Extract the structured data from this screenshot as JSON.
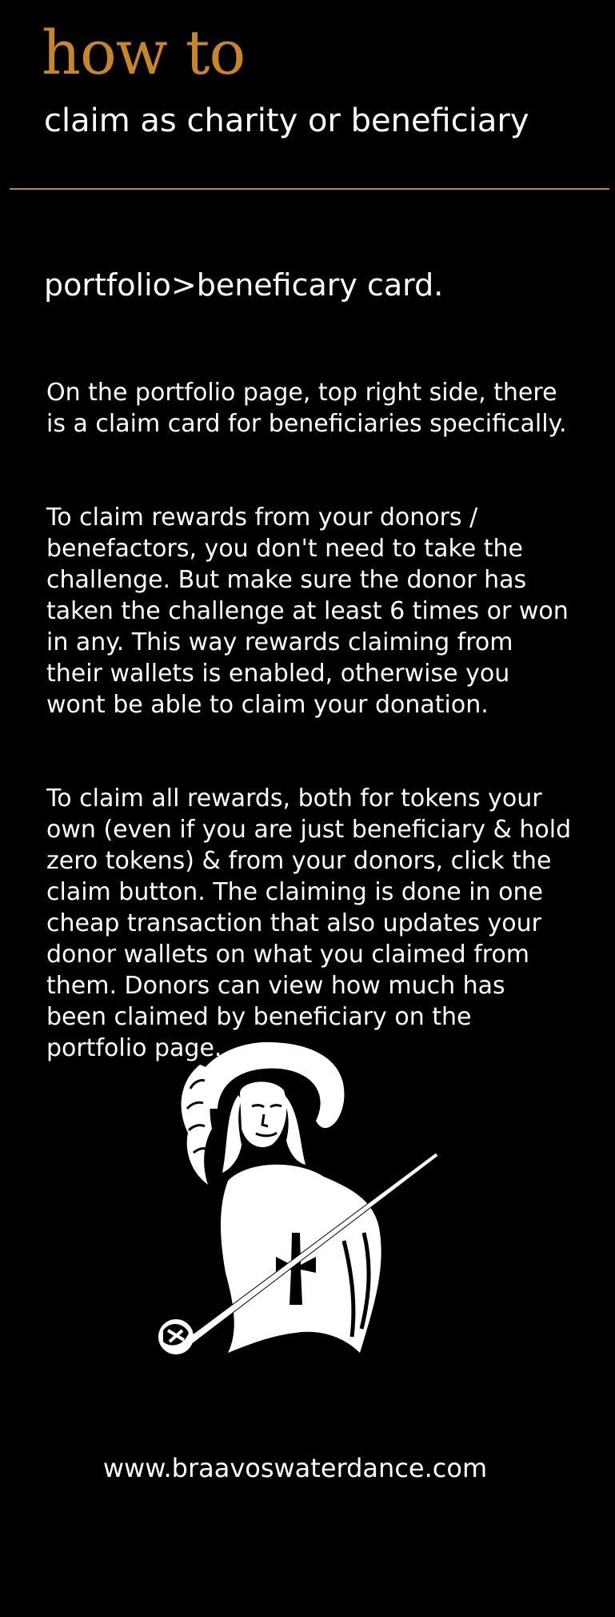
{
  "header": {
    "title": "how to",
    "subtitle": "claim as charity or beneficiary"
  },
  "section": {
    "title": "portfolio>beneficary card.",
    "paragraphs": [
      "On the portfolio page, top right side, there\nis a claim card for beneficiaries specifically.",
      "To claim rewards from your donors /\nbenefactors, you don't need to take the\nchallenge. But make sure the donor has\ntaken the challenge at least 6 times or won\nin any. This way rewards claiming from\ntheir wallets is enabled, otherwise you\nwont be able to claim your donation.",
      "To claim all rewards, both for tokens your\nown (even if you are just beneficiary & hold\nzero tokens) & from your donors, click the\nclaim button. The claiming is done in one\ncheap transaction that also updates your\ndonor wallets on what you claimed from\nthem. Donors can view how much has\nbeen claimed by beneficiary on the\nportfolio page."
    ]
  },
  "emblem": {
    "icon": "swordsman-emblem-icon"
  },
  "footer": {
    "url": "www.braavoswaterdance.com"
  },
  "colors": {
    "background": "#000000",
    "accent": "#c8862a",
    "text": "#ffffff"
  }
}
